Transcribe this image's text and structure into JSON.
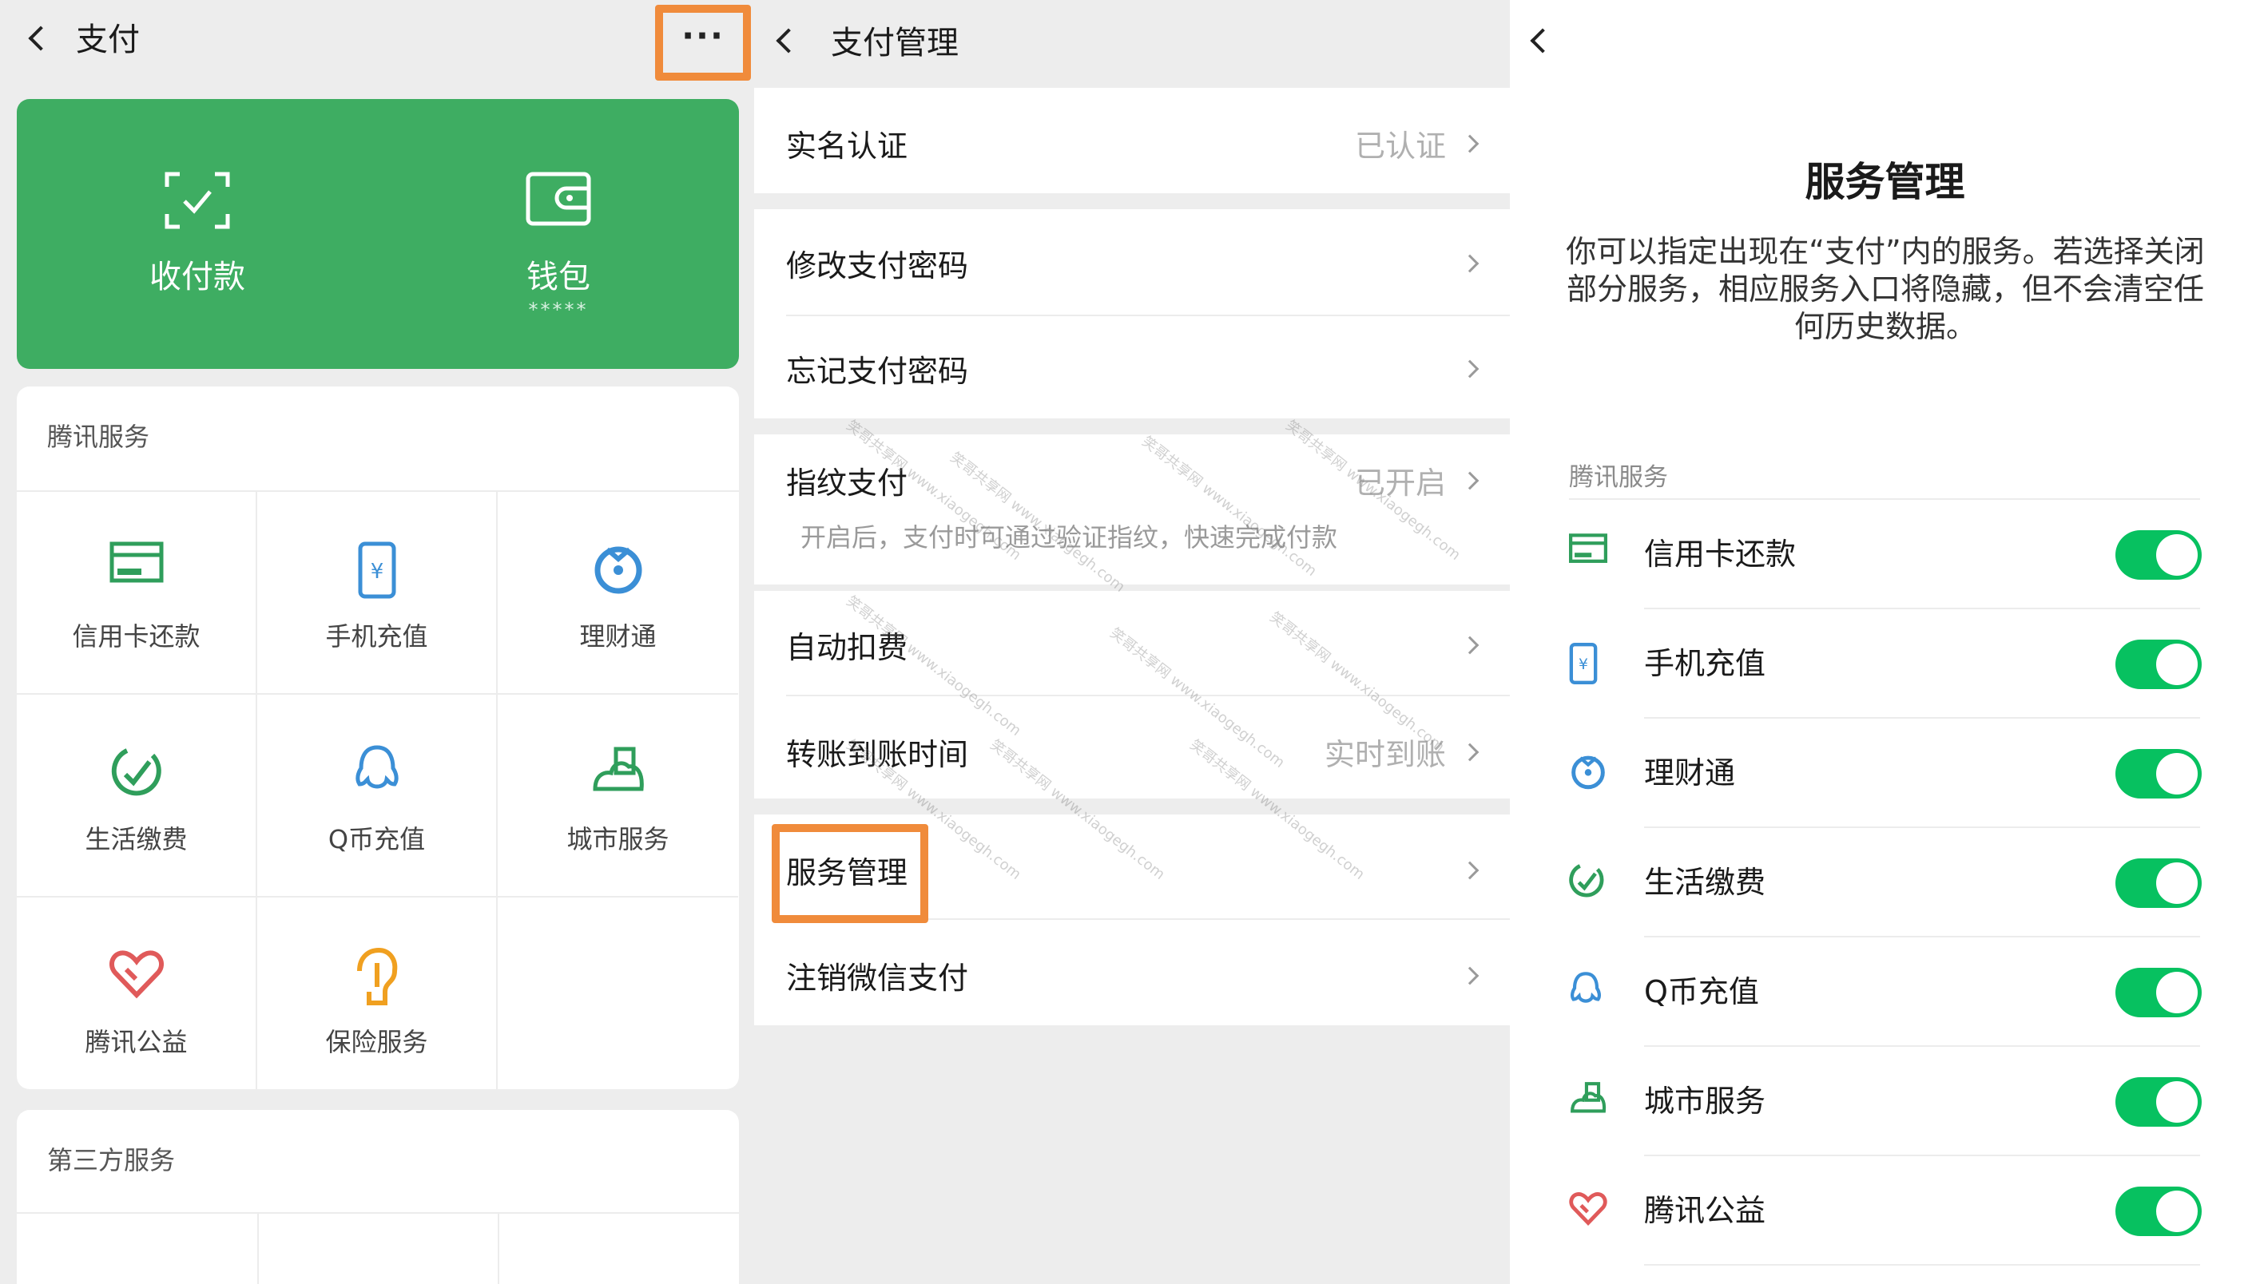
{
  "colors": {
    "wechat_green": "#3ead62",
    "toggle_on": "#07c160",
    "highlight_orange": "#f08b3b",
    "background_gray": "#ededed"
  },
  "panel1": {
    "title": "支付",
    "more_label": "···",
    "wallet_card": {
      "receive_pay": "收付款",
      "wallet": "钱包",
      "wallet_masked": "*****"
    },
    "tencent_services": {
      "title": "腾讯服务",
      "items": [
        {
          "label": "信用卡还款",
          "icon": "credit-card-icon"
        },
        {
          "label": "手机充值",
          "icon": "phone-recharge-icon"
        },
        {
          "label": "理财通",
          "icon": "licaitong-icon"
        },
        {
          "label": "生活缴费",
          "icon": "utility-bill-icon"
        },
        {
          "label": "Q币充值",
          "icon": "qq-coin-icon"
        },
        {
          "label": "城市服务",
          "icon": "city-service-icon"
        },
        {
          "label": "腾讯公益",
          "icon": "charity-icon"
        },
        {
          "label": "保险服务",
          "icon": "insurance-icon"
        }
      ]
    },
    "third_party_services": {
      "title": "第三方服务"
    }
  },
  "panel2": {
    "title": "支付管理",
    "rows": {
      "realname": {
        "label": "实名认证",
        "value": "已认证"
      },
      "change_pwd": {
        "label": "修改支付密码"
      },
      "forgot_pwd": {
        "label": "忘记支付密码"
      },
      "fingerprint": {
        "label": "指纹支付",
        "value": "已开启",
        "sub": "开启后，支付时可通过验证指纹，快速完成付款"
      },
      "auto_deduct": {
        "label": "自动扣费"
      },
      "transfer_time": {
        "label": "转账到账时间",
        "value": "实时到账"
      },
      "service_mgmt": {
        "label": "服务管理"
      },
      "cancel_pay": {
        "label": "注销微信支付"
      }
    },
    "watermark": "笑哥共享网 www.xiaogegh.com"
  },
  "panel3": {
    "title": "服务管理",
    "description": "你可以指定出现在“支付”内的服务。若选择关闭部分服务，相应服务入口将隐藏，但不会清空任何历史数据。",
    "section_title": "腾讯服务",
    "toggles": [
      {
        "label": "信用卡还款",
        "icon": "credit-card-icon",
        "on": true
      },
      {
        "label": "手机充值",
        "icon": "phone-recharge-icon",
        "on": true
      },
      {
        "label": "理财通",
        "icon": "licaitong-icon",
        "on": true
      },
      {
        "label": "生活缴费",
        "icon": "utility-bill-icon",
        "on": true
      },
      {
        "label": "Q币充值",
        "icon": "qq-coin-icon",
        "on": true
      },
      {
        "label": "城市服务",
        "icon": "city-service-icon",
        "on": true
      },
      {
        "label": "腾讯公益",
        "icon": "charity-icon",
        "on": true
      }
    ]
  }
}
